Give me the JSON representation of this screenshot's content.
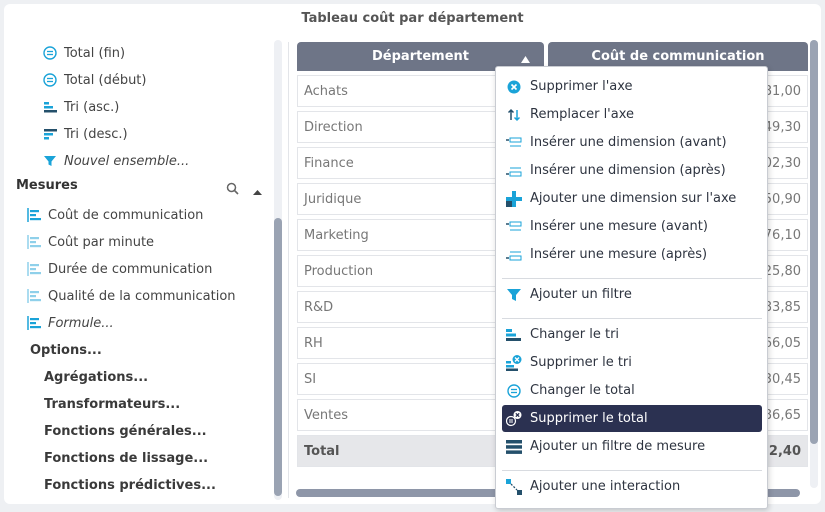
{
  "title": "Tableau coût par département",
  "tree": {
    "top_items": [
      {
        "label": "Total (fin)",
        "icon": "total-icon"
      },
      {
        "label": "Total (début)",
        "icon": "total-icon"
      },
      {
        "label": "Tri (asc.)",
        "icon": "sort-asc-icon"
      },
      {
        "label": "Tri (desc.)",
        "icon": "sort-desc-icon"
      },
      {
        "label": "Nouvel ensemble...",
        "icon": "filter-funnel-icon"
      }
    ],
    "measures_title": "Mesures",
    "measures": [
      "Coût de communication",
      "Coût par minute",
      "Durée de communication",
      "Qualité de la communication",
      "Formule..."
    ],
    "options_title": "Options...",
    "options": [
      "Agrégations...",
      "Transformateurs...",
      "Fonctions générales...",
      "Fonctions de lissage...",
      "Fonctions prédictives..."
    ]
  },
  "table": {
    "columns": [
      "Département",
      "Coût de communication"
    ],
    "rows": [
      {
        "dept": "Achats",
        "value": "81,00"
      },
      {
        "dept": "Direction",
        "value": "49,30"
      },
      {
        "dept": "Finance",
        "value": "02,30"
      },
      {
        "dept": "Juridique",
        "value": "50,90"
      },
      {
        "dept": "Marketing",
        "value": "76,10"
      },
      {
        "dept": "Production",
        "value": "25,80"
      },
      {
        "dept": "R&D",
        "value": "83,85"
      },
      {
        "dept": "RH",
        "value": "66,05"
      },
      {
        "dept": "SI",
        "value": "30,45"
      },
      {
        "dept": "Ventes",
        "value": "86,65"
      }
    ],
    "total": {
      "dept": "Total",
      "value": "52,40"
    }
  },
  "menu": {
    "items": [
      "Supprimer l'axe",
      "Remplacer l'axe",
      "Insérer une dimension (avant)",
      "Insérer une dimension (après)",
      "Ajouter une dimension sur l'axe",
      "Insérer une mesure (avant)",
      "Insérer une mesure (après)",
      "Ajouter un filtre",
      "Changer le tri",
      "Supprimer le tri",
      "Changer le total",
      "Supprimer le total",
      "Ajouter un filtre de mesure",
      "Ajouter une interaction"
    ],
    "active_item": "Supprimer le total"
  },
  "colors": {
    "accent": "#1aa3d8",
    "header": "#6e7587",
    "menu_active": "#2b3151",
    "icon_dark": "#24506b"
  }
}
